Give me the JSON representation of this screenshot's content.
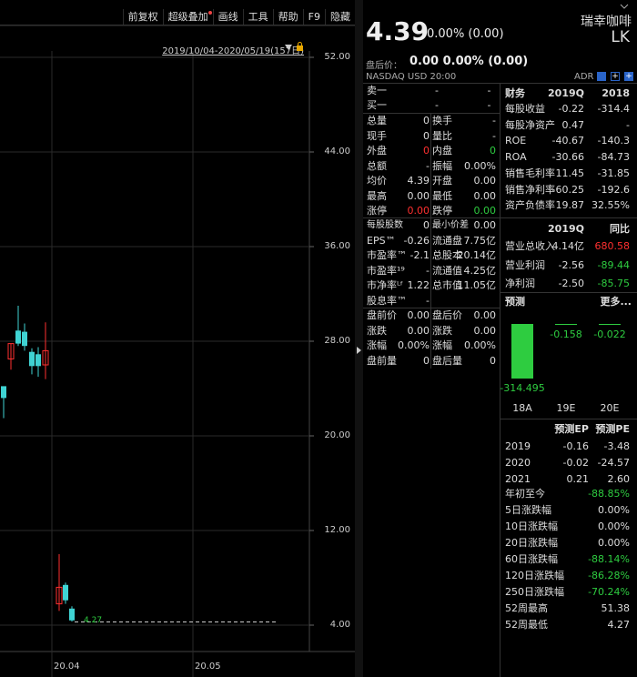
{
  "toolbar": {
    "items": [
      "前复权",
      "超级叠加",
      "画线",
      "工具",
      "帮助",
      "F9",
      "隐藏"
    ]
  },
  "chart": {
    "range_label": "2019/10/04-2020/05/19(157日)",
    "y_ticks": [
      "52.00",
      "44.00",
      "36.00",
      "28.00",
      "20.00",
      "12.00",
      "4.00"
    ],
    "x_ticks": [
      "20.04",
      "20.05"
    ],
    "last_price_label": "4.27"
  },
  "chart_data": {
    "type": "candlestick",
    "ylim": [
      4,
      52
    ],
    "x_ticks": [
      "20.04",
      "20.05"
    ],
    "y_ticks": [
      52,
      44,
      36,
      28,
      20,
      12,
      4
    ],
    "candles": [
      {
        "open": 23.2,
        "high": 24.0,
        "low": 21.5,
        "close": 24.2,
        "color": "cyan"
      },
      {
        "open": 26.5,
        "high": 27.8,
        "low": 25.6,
        "close": 27.8,
        "color": "red"
      },
      {
        "open": 28.9,
        "high": 31.0,
        "low": 27.6,
        "close": 27.8,
        "color": "cyan"
      },
      {
        "open": 28.8,
        "high": 29.5,
        "low": 27.2,
        "close": 27.6,
        "color": "cyan"
      },
      {
        "open": 27.1,
        "high": 27.4,
        "low": 25.2,
        "close": 25.9,
        "color": "cyan"
      },
      {
        "open": 26.9,
        "high": 27.5,
        "low": 25.0,
        "close": 25.9,
        "color": "cyan"
      },
      {
        "open": 27.2,
        "high": 29.6,
        "low": 24.8,
        "close": 26.0,
        "color": "red"
      },
      {
        "open": 5.8,
        "high": 10.0,
        "low": 5.2,
        "close": 7.2,
        "color": "red"
      },
      {
        "open": 7.4,
        "high": 7.6,
        "low": 5.8,
        "close": 6.1,
        "color": "cyan"
      },
      {
        "open": 5.4,
        "high": 5.6,
        "low": 4.3,
        "close": 4.4,
        "color": "cyan"
      }
    ],
    "last_price": 4.27
  },
  "quote": {
    "price": "4.39",
    "change": "0.00% (0.00)",
    "name": "瑞幸咖啡",
    "code": "LK",
    "premarket_label": "盘后价：",
    "premarket_value": "0.00  0.00% (0.00)",
    "exchange": "NASDAQ   USD   20:00",
    "adr": "ADR"
  },
  "orderbook": [
    {
      "label": "卖一",
      "v1": "-",
      "v2": "-"
    },
    {
      "label": "买一",
      "v1": "-",
      "v2": "-"
    }
  ],
  "stats_left": [
    {
      "l1": "总量",
      "v1": "0",
      "l2": "换手",
      "v2": "-",
      "c1": "white",
      "c2": "white"
    },
    {
      "l1": "现手",
      "v1": "0",
      "l2": "量比",
      "v2": "-",
      "c1": "white",
      "c2": "white"
    },
    {
      "l1": "外盘",
      "v1": "0",
      "l2": "内盘",
      "v2": "0",
      "c1": "red",
      "c2": "green"
    },
    {
      "l1": "总额",
      "v1": "-",
      "l2": "振幅",
      "v2": "0.00%",
      "c1": "white",
      "c2": "white"
    },
    {
      "l1": "均价",
      "v1": "4.39",
      "l2": "开盘",
      "v2": "0.00",
      "c1": "white",
      "c2": "white"
    },
    {
      "l1": "最高",
      "v1": "0.00",
      "l2": "最低",
      "v2": "0.00",
      "c1": "white",
      "c2": "white"
    },
    {
      "l1": "涨停",
      "v1": "0.00",
      "l2": "跌停",
      "v2": "0.00",
      "c1": "red",
      "c2": "green"
    }
  ],
  "stats_mid": [
    {
      "l1": "每股股数",
      "v1": "0",
      "l2": "最小价差",
      "v2": "0.00"
    },
    {
      "l1": "EPS™",
      "v1": "-0.26",
      "l2": "流通盘",
      "v2": "7.75亿"
    },
    {
      "l1": "市盈率™",
      "v1": "-2.1",
      "l2": "总股本",
      "v2": "20.14亿"
    },
    {
      "l1": "市盈率¹⁹",
      "v1": "-",
      "l2": "流通值",
      "v2": "4.25亿"
    },
    {
      "l1": "市净率ᴸᶠ",
      "v1": "1.22",
      "l2": "总市值",
      "v2": "11.05亿"
    },
    {
      "l1": "股息率™",
      "v1": "-",
      "l2": "",
      "v2": ""
    }
  ],
  "stats_after": [
    {
      "l1": "盘前价",
      "v1": "0.00",
      "l2": "盘后价",
      "v2": "0.00"
    },
    {
      "l1": "涨跌",
      "v1": "0.00",
      "l2": "涨跌",
      "v2": "0.00"
    },
    {
      "l1": "涨幅",
      "v1": "0.00%",
      "l2": "涨幅",
      "v2": "0.00%"
    },
    {
      "l1": "盘前量",
      "v1": "0",
      "l2": "盘后量",
      "v2": "0"
    }
  ],
  "finance": {
    "header": [
      "财务",
      "2019Q",
      "2018"
    ],
    "rows": [
      {
        "label": "每股收益",
        "a": "-0.22",
        "b": "-314.4"
      },
      {
        "label": "每股净资产",
        "a": "0.47",
        "b": "-"
      },
      {
        "label": "ROE",
        "a": "-40.67",
        "b": "-140.3"
      },
      {
        "label": "ROA",
        "a": "-30.66",
        "b": "-84.73"
      },
      {
        "label": "销售毛利率",
        "a": "11.45",
        "b": "-31.85"
      },
      {
        "label": "销售净利率",
        "a": "-60.25",
        "b": "-192.6"
      },
      {
        "label": "资产负债率",
        "a": "19.87",
        "b": "32.55%"
      }
    ],
    "header2": [
      "2019Q",
      "同比"
    ],
    "rows2": [
      {
        "label": "营业总收入",
        "a": "4.14亿",
        "b": "680.58",
        "bc": "red"
      },
      {
        "label": "营业利润",
        "a": "-2.56",
        "b": "-89.44",
        "bc": "green"
      },
      {
        "label": "净利润",
        "a": "-2.50",
        "b": "-85.75",
        "bc": "green"
      }
    ]
  },
  "forecast": {
    "title": "预测",
    "more": "更多...",
    "bars": [
      {
        "value": -314.495,
        "label": "-314.495",
        "year": "18A"
      },
      {
        "value": -0.158,
        "label": "-0.158",
        "year": "19E"
      },
      {
        "value": -0.022,
        "label": "-0.022",
        "year": "20E"
      }
    ],
    "table_header": [
      "预测EP",
      "预测PE"
    ],
    "rows": [
      {
        "year": "2019",
        "ep": "-0.16",
        "pe": "-3.48"
      },
      {
        "year": "2020",
        "ep": "-0.02",
        "pe": "-24.57"
      },
      {
        "year": "2021",
        "ep": "0.21",
        "pe": "2.60"
      }
    ],
    "perf": [
      {
        "label": "年初至今",
        "value": "-88.85%",
        "c": "green"
      },
      {
        "label": "5日涨跌幅",
        "value": "0.00%",
        "c": "white"
      },
      {
        "label": "10日涨跌幅",
        "value": "0.00%",
        "c": "white"
      },
      {
        "label": "20日涨跌幅",
        "value": "0.00%",
        "c": "white"
      },
      {
        "label": "60日涨跌幅",
        "value": "-88.14%",
        "c": "green"
      },
      {
        "label": "120日涨跌幅",
        "value": "-86.28%",
        "c": "green"
      },
      {
        "label": "250日涨跌幅",
        "value": "-70.24%",
        "c": "green"
      },
      {
        "label": "52周最高",
        "value": "51.38",
        "c": "white"
      },
      {
        "label": "52周最低",
        "value": "4.27",
        "c": "white"
      }
    ]
  },
  "colors": {
    "up": "#ff3030",
    "down": "#3fd3d3",
    "green": "#2ecc40"
  }
}
